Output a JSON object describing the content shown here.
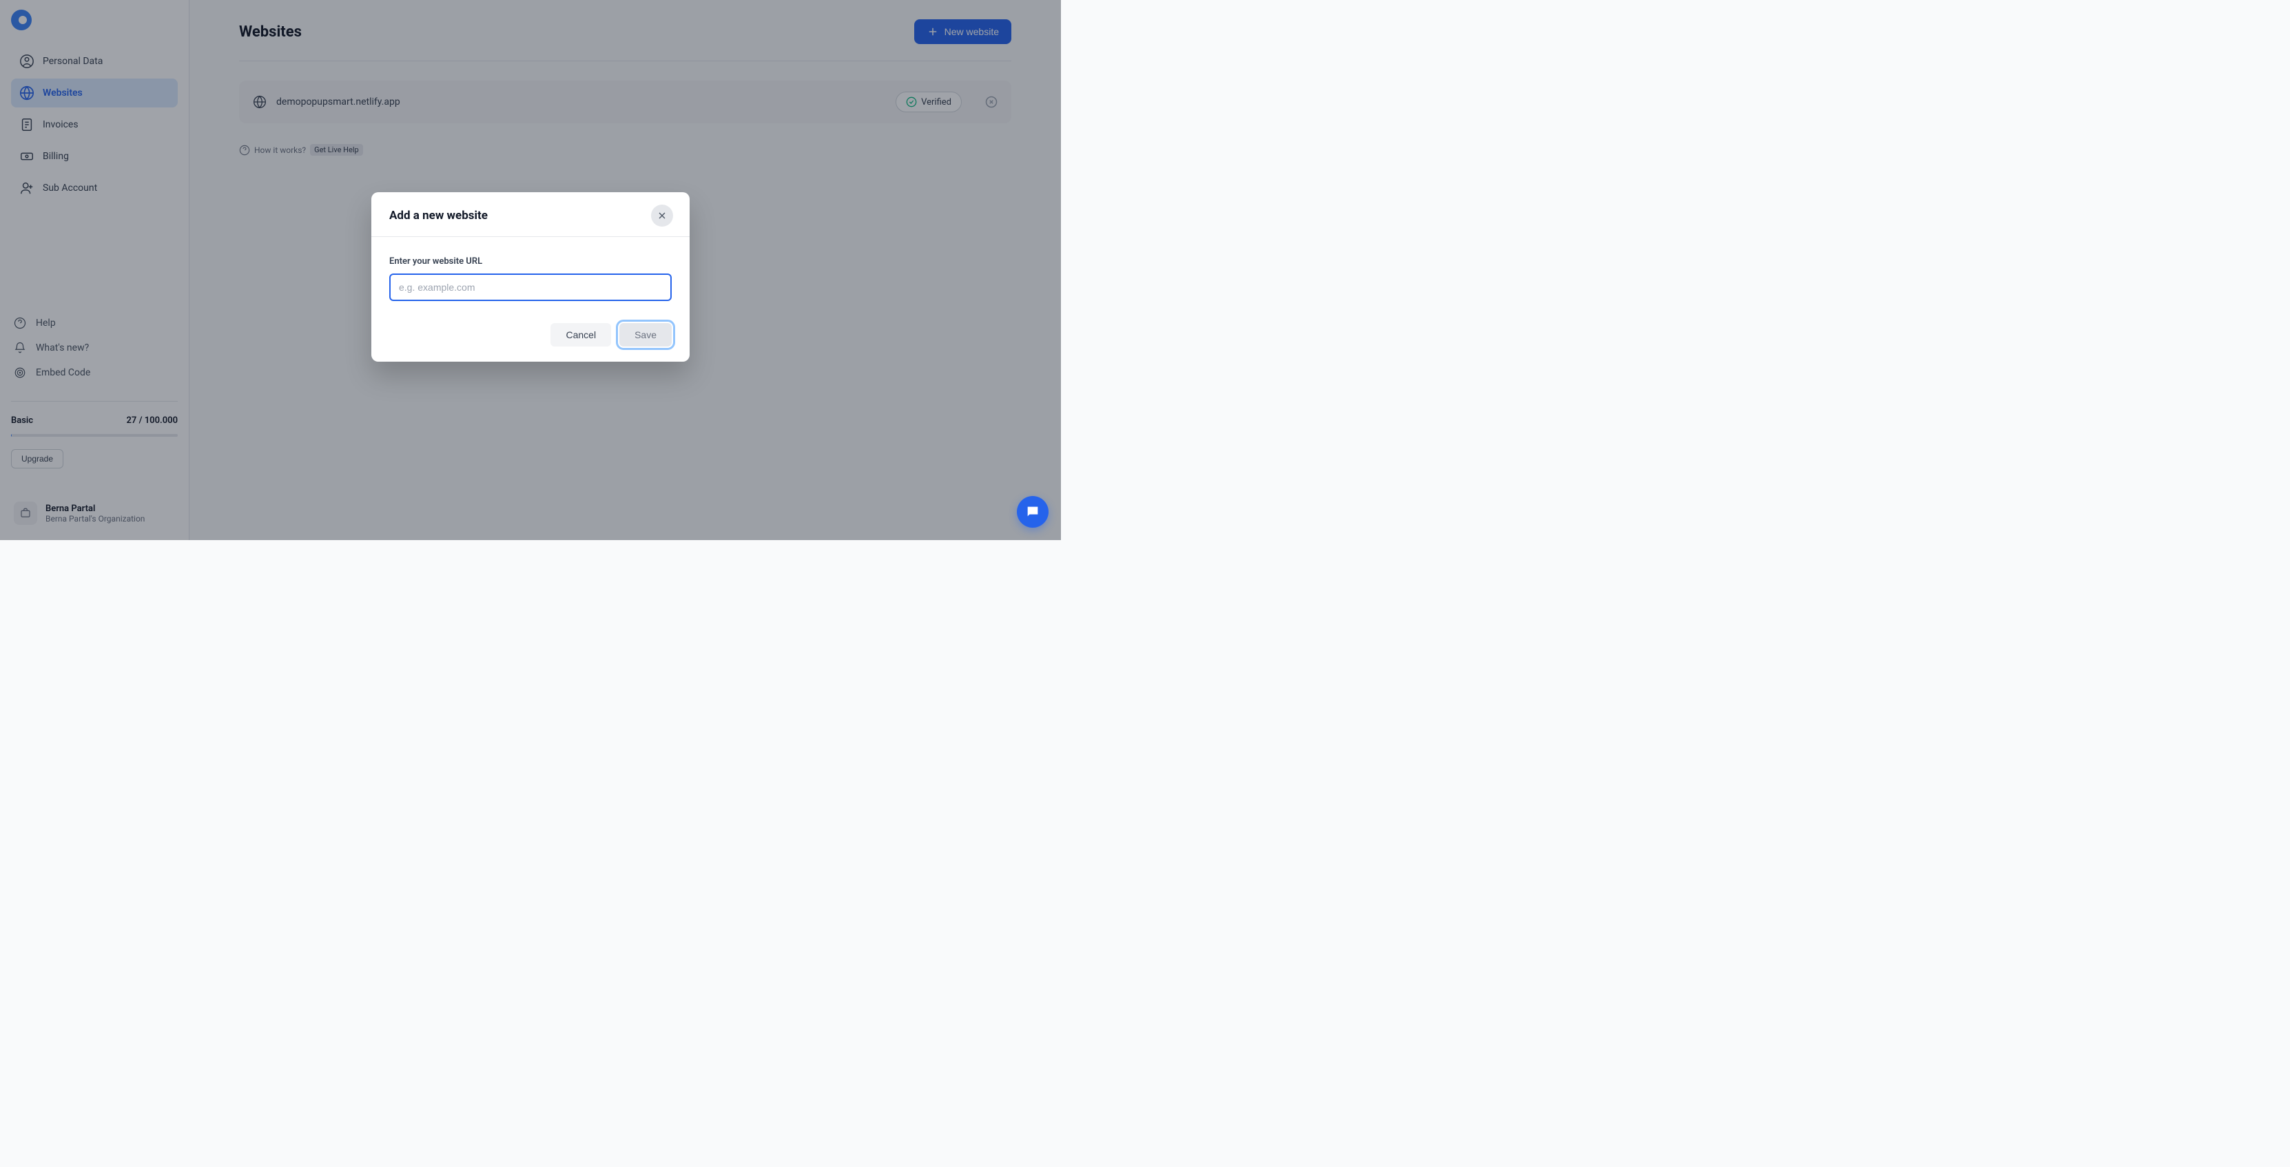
{
  "sidebar": {
    "nav": [
      {
        "label": "Personal Data"
      },
      {
        "label": "Websites"
      },
      {
        "label": "Invoices"
      },
      {
        "label": "Billing"
      },
      {
        "label": "Sub Account"
      }
    ],
    "bottom_nav": [
      {
        "label": "Help"
      },
      {
        "label": "What's new?"
      },
      {
        "label": "Embed Code"
      }
    ],
    "plan": {
      "name": "Basic",
      "usage": "27 / 100.000",
      "upgrade_label": "Upgrade"
    },
    "user": {
      "name": "Berna Partal",
      "org": "Berna Partal's Organization"
    }
  },
  "main": {
    "title": "Websites",
    "new_website_label": "New website",
    "websites": [
      {
        "domain": "demopopupsmart.netlify.app",
        "status": "Verified"
      }
    ],
    "help_text": "How it works?",
    "help_link": "Get Live Help"
  },
  "modal": {
    "title": "Add a new website",
    "input_label": "Enter your website URL",
    "placeholder": "e.g. example.com",
    "cancel_label": "Cancel",
    "save_label": "Save"
  }
}
